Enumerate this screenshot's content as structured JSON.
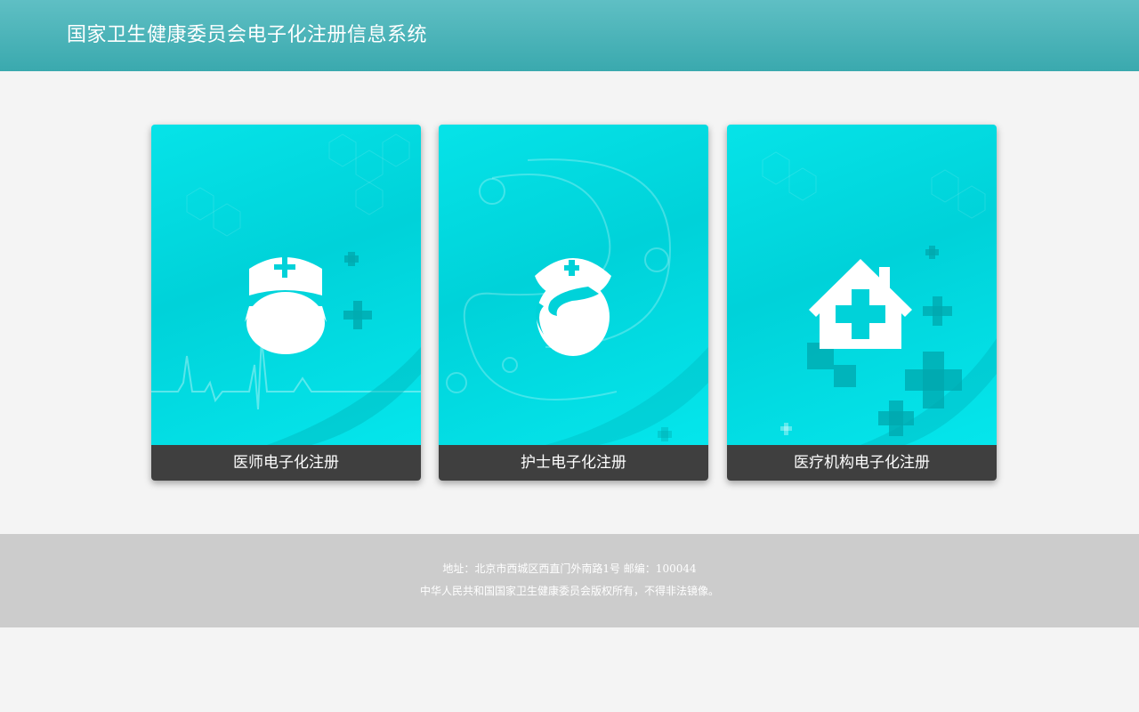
{
  "header": {
    "title": "国家卫生健康委员会电子化注册信息系统"
  },
  "cards": [
    {
      "label": "医师电子化注册",
      "icon": "doctor-icon"
    },
    {
      "label": "护士电子化注册",
      "icon": "nurse-icon"
    },
    {
      "label": "医疗机构电子化注册",
      "icon": "hospital-icon"
    }
  ],
  "footer": {
    "address": "地址：北京市西城区西直门外南路1号 邮编：100044",
    "copyright": "中华人民共和国国家卫生健康委员会版权所有，不得非法镜像。"
  },
  "colors": {
    "header": "#3aa9ae",
    "card_bg": "#00d9df",
    "label_bg": "#3f3f3f",
    "footer_bg": "#cccccc"
  }
}
